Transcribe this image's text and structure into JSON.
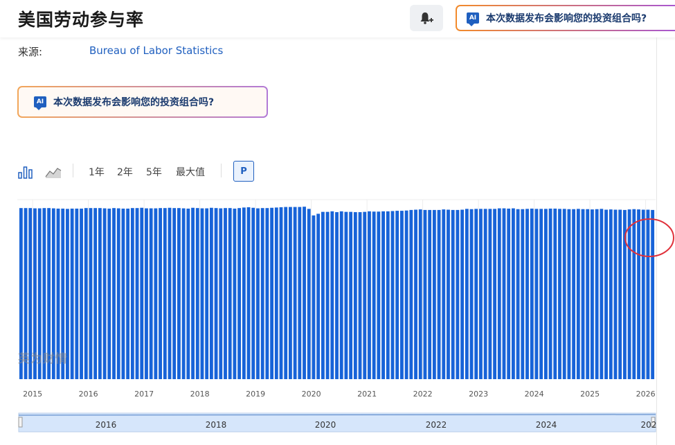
{
  "page": {
    "title": "美国劳动参与率",
    "source_label": "来源:",
    "source_name": "Bureau of Labor Statistics",
    "ai_prompt": "本次数据发布会影响您的投资组合吗?",
    "ai_badge": "AI",
    "watermark": "英为财情"
  },
  "toolbar": {
    "bar_icon": "bar-chart-icon",
    "area_icon": "area-chart-icon",
    "ranges": [
      "1年",
      "2年",
      "5年",
      "最大值"
    ],
    "p_label": "P"
  },
  "colors": {
    "bar": "#1763d8",
    "accent": "#1f5fbf",
    "navigator_fill": "#d6e6fb",
    "annotation": "#e0303a"
  },
  "chart_data": {
    "type": "bar",
    "xlabel": "",
    "ylabel": "",
    "grid": true,
    "x_ticks": [
      "2015",
      "2016",
      "2017",
      "2018",
      "2019",
      "2020",
      "2021",
      "2022",
      "2023",
      "2024",
      "2025",
      "2026"
    ],
    "navigator_ticks": [
      "2016",
      "2018",
      "2020",
      "2022",
      "2024",
      "202"
    ],
    "annotation": "red circle around latest values",
    "ylim": [
      0,
      66
    ],
    "series": [
      {
        "values": [
          62.9,
          62.9,
          62.9,
          62.8,
          62.8,
          62.9,
          62.9,
          62.8,
          62.7,
          62.7,
          62.6,
          62.7,
          62.7,
          62.7,
          62.9,
          62.9,
          62.9,
          62.9,
          62.8,
          62.7,
          62.9,
          62.8,
          62.7,
          62.7,
          62.9,
          62.9,
          63.0,
          62.8,
          62.8,
          62.8,
          62.9,
          62.9,
          63.0,
          62.9,
          62.9,
          62.8,
          62.7,
          63.0,
          62.9,
          62.8,
          62.8,
          63.0,
          62.9,
          62.8,
          62.9,
          62.9,
          62.7,
          62.9,
          63.1,
          63.2,
          63.0,
          62.8,
          62.9,
          62.9,
          63.0,
          63.1,
          63.2,
          63.3,
          63.3,
          63.3,
          63.3,
          63.4,
          62.6,
          60.2,
          60.8,
          61.5,
          61.5,
          61.7,
          61.4,
          61.7,
          61.5,
          61.5,
          61.4,
          61.4,
          61.5,
          61.7,
          61.6,
          61.6,
          61.7,
          61.7,
          61.8,
          61.9,
          61.9,
          62.0,
          62.2,
          62.3,
          62.4,
          62.2,
          62.2,
          62.2,
          62.2,
          62.4,
          62.3,
          62.2,
          62.2,
          62.3,
          62.6,
          62.5,
          62.6,
          62.6,
          62.6,
          62.6,
          62.6,
          62.8,
          62.8,
          62.7,
          62.8,
          62.5,
          62.5,
          62.6,
          62.7,
          62.6,
          62.6,
          62.6,
          62.7,
          62.7,
          62.6,
          62.6,
          62.5,
          62.5,
          62.6,
          62.5,
          62.5,
          62.4,
          62.5,
          62.6,
          62.3,
          62.4,
          62.3,
          62.3,
          62.2,
          62.4,
          62.5,
          62.4,
          62.3,
          62.3,
          62.2
        ]
      }
    ]
  }
}
